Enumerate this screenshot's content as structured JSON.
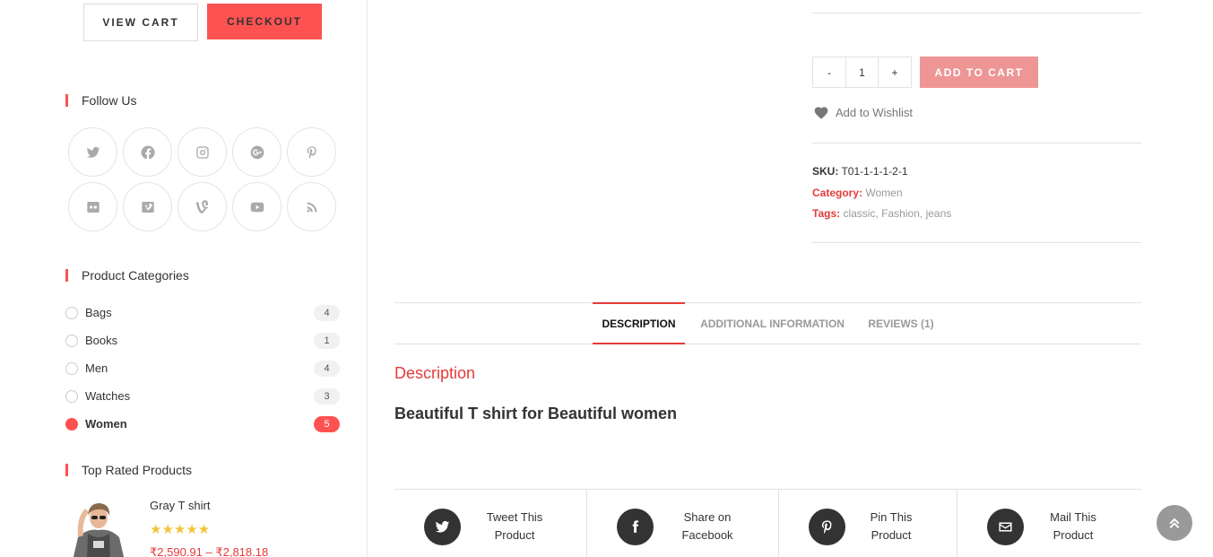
{
  "cart": {
    "view_cart": "VIEW CART",
    "checkout": "CHECKOUT"
  },
  "widgets": {
    "follow_us": "Follow Us",
    "product_categories": "Product Categories",
    "top_rated": "Top Rated Products"
  },
  "social": [
    "twitter-icon",
    "facebook-icon",
    "instagram-icon",
    "google-plus-icon",
    "pinterest-icon",
    "flickr-icon",
    "vimeo-icon",
    "vine-icon",
    "youtube-icon",
    "rss-icon"
  ],
  "categories": [
    {
      "name": "Bags",
      "count": "4",
      "active": false
    },
    {
      "name": "Books",
      "count": "1",
      "active": false
    },
    {
      "name": "Men",
      "count": "4",
      "active": false
    },
    {
      "name": "Watches",
      "count": "3",
      "active": false
    },
    {
      "name": "Women",
      "count": "5",
      "active": true
    }
  ],
  "top_rated_product": {
    "name": "Gray T shirt",
    "stars": "★★★★★",
    "rating": 5,
    "price": "₹2,590.91 – ₹2,818.18"
  },
  "product": {
    "qty_minus": "-",
    "qty_value": "1",
    "qty_plus": "+",
    "add_to_cart": "ADD TO CART",
    "wishlist": "Add to Wishlist",
    "sku_label": "SKU:",
    "sku": "T01-1-1-1-2-1",
    "category_label": "Category:",
    "category": "Women",
    "tags_label": "Tags:",
    "tags": [
      "classic",
      "Fashion",
      "jeans"
    ]
  },
  "tabs": [
    "DESCRIPTION",
    "ADDITIONAL INFORMATION",
    "REVIEWS (1)"
  ],
  "description": {
    "title": "Description",
    "text": "Beautiful T shirt for Beautiful women"
  },
  "share": [
    {
      "line1": "Tweet This",
      "line2": "Product",
      "icon": "twitter-icon"
    },
    {
      "line1": "Share on",
      "line2": "Facebook",
      "icon": "facebook-icon"
    },
    {
      "line1": "Pin This",
      "line2": "Product",
      "icon": "pinterest-icon"
    },
    {
      "line1": "Mail This",
      "line2": "Product",
      "icon": "mail-icon"
    }
  ],
  "colors": {
    "accent": "#fe5252",
    "add_to_cart": "#ee9595",
    "star": "#f2c43b"
  }
}
